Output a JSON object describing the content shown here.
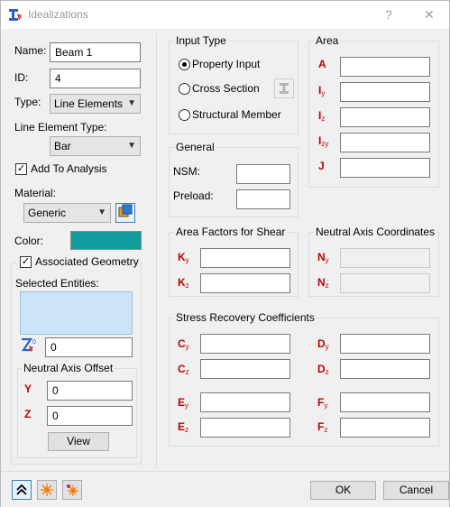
{
  "window": {
    "title": "Idealizations",
    "help_glyph": "?",
    "close_glyph": "✕"
  },
  "left": {
    "name_label": "Name:",
    "name_value": "Beam 1",
    "id_label": "ID:",
    "id_value": "4",
    "type_label": "Type:",
    "type_value": "Line Elements",
    "line_element_type_label": "Line Element Type:",
    "line_element_type_value": "Bar",
    "add_to_analysis_label": "Add To Analysis",
    "add_to_analysis_checked": true,
    "material_label": "Material:",
    "material_value": "Generic",
    "color_label": "Color:",
    "color_value": "#119d9d",
    "associated_geometry_label": "Associated Geometry",
    "associated_geometry_checked": true,
    "selected_entities_label": "Selected Entities:",
    "entity_count_value": "0",
    "neutral_axis_offset_title": "Neutral Axis Offset",
    "offset_y_label": "Y",
    "offset_y_value": "0",
    "offset_z_label": "Z",
    "offset_z_value": "0",
    "view_button": "View"
  },
  "input_type": {
    "title": "Input Type",
    "options": [
      "Property Input",
      "Cross Section",
      "Structural Member"
    ],
    "selected": "Property Input"
  },
  "general": {
    "title": "General",
    "nsm_label": "NSM:",
    "nsm_value": "",
    "preload_label": "Preload:",
    "preload_value": ""
  },
  "area": {
    "title": "Area",
    "rows": [
      {
        "sym": "A",
        "sub": "",
        "value": ""
      },
      {
        "sym": "I",
        "sub": "y",
        "value": ""
      },
      {
        "sym": "I",
        "sub": "z",
        "value": ""
      },
      {
        "sym": "I",
        "sub": "zy",
        "value": ""
      },
      {
        "sym": "J",
        "sub": "",
        "value": ""
      }
    ]
  },
  "shear": {
    "title": "Area Factors for Shear",
    "rows": [
      {
        "sym": "K",
        "sub": "y",
        "value": ""
      },
      {
        "sym": "K",
        "sub": "z",
        "value": ""
      }
    ]
  },
  "neutral_axis": {
    "title": "Neutral Axis Coordinates",
    "rows": [
      {
        "sym": "N",
        "sub": "y",
        "value": ""
      },
      {
        "sym": "N",
        "sub": "z",
        "value": ""
      }
    ]
  },
  "stress_recovery": {
    "title": "Stress Recovery Coefficients",
    "left_rows": [
      {
        "sym": "C",
        "sub": "y",
        "value": ""
      },
      {
        "sym": "C",
        "sub": "z",
        "value": ""
      },
      {
        "sym": "E",
        "sub": "y",
        "value": ""
      },
      {
        "sym": "E",
        "sub": "z",
        "value": ""
      }
    ],
    "right_rows": [
      {
        "sym": "D",
        "sub": "y",
        "value": ""
      },
      {
        "sym": "D",
        "sub": "z",
        "value": ""
      },
      {
        "sym": "F",
        "sub": "y",
        "value": ""
      },
      {
        "sym": "F",
        "sub": "z",
        "value": ""
      }
    ]
  },
  "footer": {
    "ok_label": "OK",
    "cancel_label": "Cancel"
  },
  "icons": {
    "app": "idealization-icon",
    "material_browse": "material-library-icon",
    "cross_section_browse": "cross-section-icon",
    "entity_pick": "entity-pick-icon",
    "collapse": "double-chevron-up-icon",
    "star1": "sparkle-icon",
    "star2": "multi-sparkle-icon"
  }
}
